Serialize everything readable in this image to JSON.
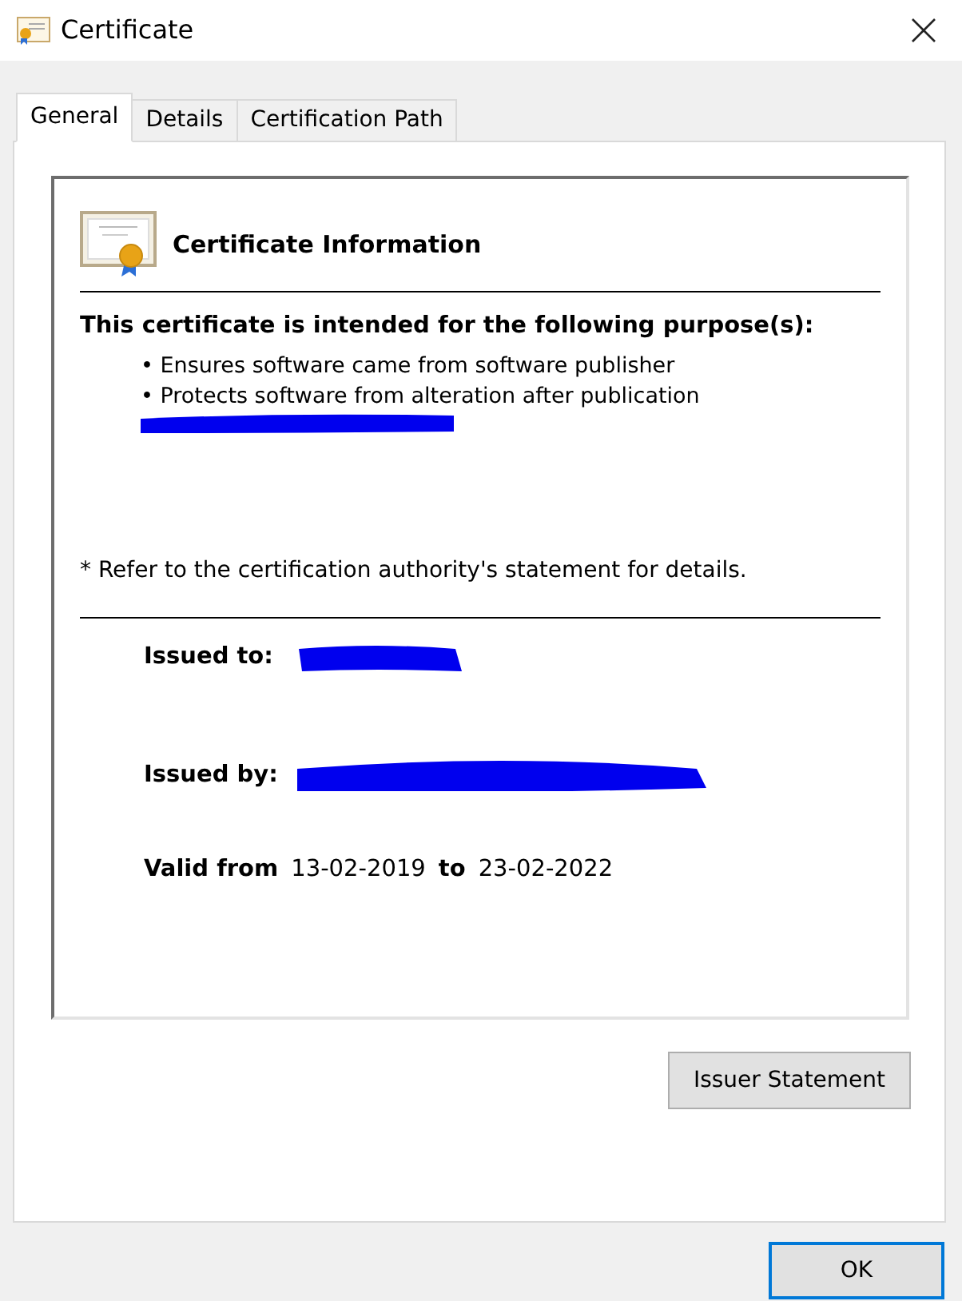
{
  "window": {
    "title": "Certificate"
  },
  "tabs": [
    {
      "label": "General",
      "selected": true
    },
    {
      "label": "Details",
      "selected": false
    },
    {
      "label": "Certification Path",
      "selected": false
    }
  ],
  "info": {
    "heading": "Certificate Information",
    "purpose_heading": "This certificate is intended for the following purpose(s):",
    "purposes": [
      "• Ensures software came from software publisher",
      "• Protects software from alteration after publication"
    ],
    "note": "* Refer to the certification authority's statement for details."
  },
  "fields": [
    {
      "label": "Issued to:"
    },
    {
      "label": "Issued by:"
    }
  ],
  "validity": {
    "label_from": "Valid from",
    "from": "13-02-2019",
    "label_to": "to",
    "to": "23-02-2022"
  },
  "issuer_button": "Issuer Statement",
  "buttons": [
    {
      "label": "OK",
      "default": true
    }
  ]
}
